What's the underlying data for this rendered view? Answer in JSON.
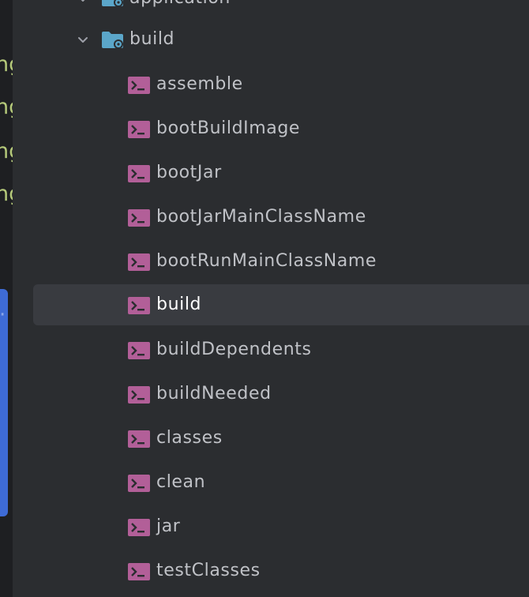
{
  "tree": {
    "parent_folder": {
      "label": "application",
      "icon": "folder-gear-icon"
    },
    "build_folder": {
      "label": "build",
      "icon": "folder-gear-icon",
      "expanded": true
    },
    "tasks": [
      {
        "label": "assemble"
      },
      {
        "label": "bootBuildImage"
      },
      {
        "label": "bootJar"
      },
      {
        "label": "bootJarMainClassName"
      },
      {
        "label": "bootRunMainClassName"
      },
      {
        "label": "build",
        "selected": true
      },
      {
        "label": "buildDependents"
      },
      {
        "label": "buildNeeded"
      },
      {
        "label": "classes"
      },
      {
        "label": "clean"
      },
      {
        "label": "jar"
      },
      {
        "label": "testClasses"
      }
    ],
    "task_icon": "gradle-task-icon"
  },
  "colors": {
    "background": "#2b2d30",
    "selected_row": "#393b40",
    "label": "#c0c2c7",
    "selected_label": "#ffffff",
    "task_icon": "#b25f98",
    "folder_icon": "#5ba6c9",
    "accent_panel": "#3e6bd6"
  }
}
